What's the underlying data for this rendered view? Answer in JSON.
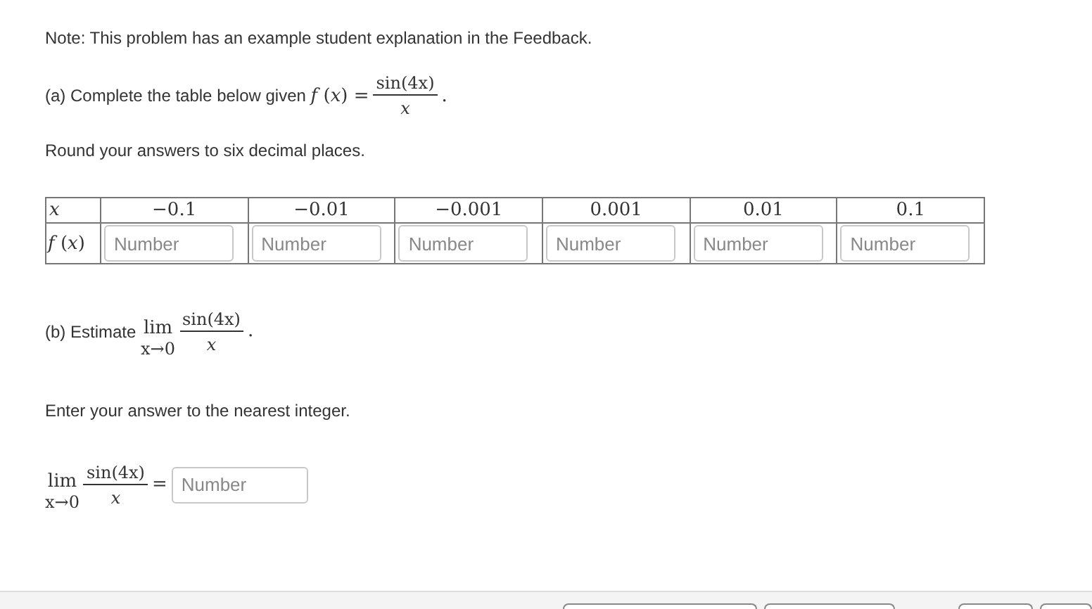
{
  "note": "Note: This problem has an example student explanation in the Feedback.",
  "part_a": {
    "prompt": "(a) Complete the table below given",
    "function": "*f* (*x*) =",
    "numerator": "sin(4x)",
    "denominator": "*x*",
    "end": "."
  },
  "rounding": "Round your answers to six decimal places.",
  "table": {
    "x_label": "x",
    "fx_label": "*f* (*x*)",
    "x_values": [
      "−0.1",
      "−0.01",
      "−0.001",
      "0.001",
      "0.01",
      "0.1"
    ],
    "inputs": [
      {
        "placeholder": "Number"
      },
      {
        "placeholder": "Number"
      },
      {
        "placeholder": "Number"
      },
      {
        "placeholder": "Number"
      },
      {
        "placeholder": "Number"
      },
      {
        "placeholder": "Number"
      }
    ]
  },
  "part_b": {
    "prompt": "(b) Estimate",
    "lim": "lim",
    "lim_sub": "x→0",
    "numerator": "sin(4x)",
    "denominator": "*x*",
    "end": "."
  },
  "instruction": "Enter your answer to the nearest integer.",
  "answer": {
    "lim": "lim",
    "lim_sub": "x→0",
    "numerator": "sin(4x)",
    "denominator": "*x*",
    "equals": "=",
    "placeholder": "Number"
  }
}
